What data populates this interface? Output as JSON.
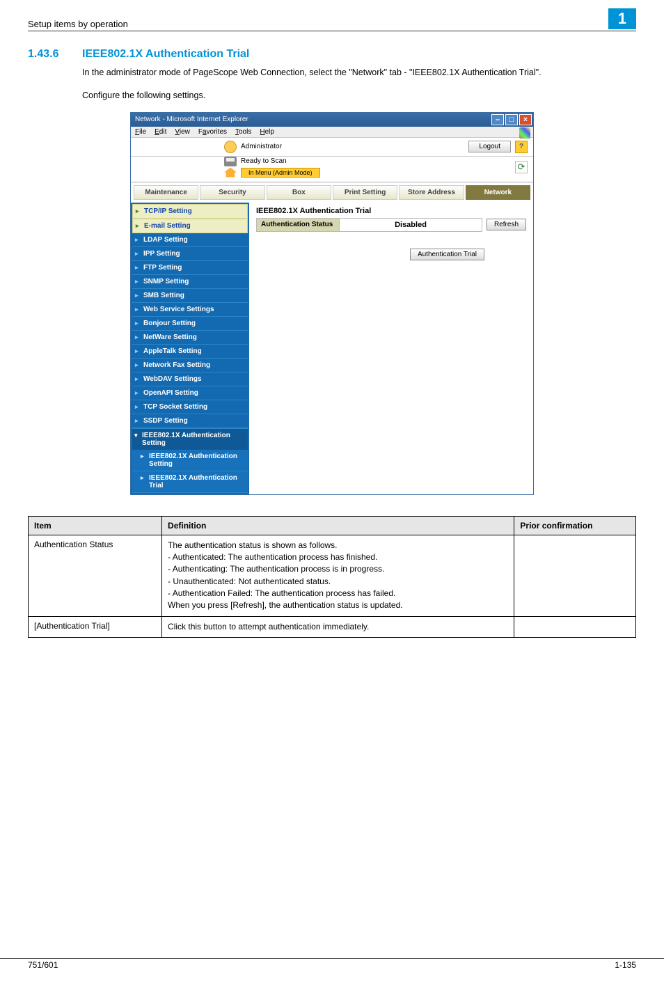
{
  "header": {
    "breadcrumb": "Setup items by operation",
    "chapter_badge": "1"
  },
  "section": {
    "number": "1.43.6",
    "title": "IEEE802.1X Authentication Trial",
    "para1": "In the administrator mode of PageScope Web Connection, select the \"Network\" tab - \"IEEE802.1X Authentication Trial\".",
    "para2": "Configure the following settings."
  },
  "browser": {
    "title": "Network - Microsoft Internet Explorer",
    "menus": {
      "file": "File",
      "edit": "Edit",
      "view": "View",
      "favorites": "Favorites",
      "tools": "Tools",
      "help": "Help"
    },
    "admin_label": "Administrator",
    "logout_label": "Logout",
    "ready_label": "Ready to Scan",
    "admin_mode_label": "In Menu (Admin Mode)",
    "tabs": {
      "maintenance": "Maintenance",
      "security": "Security",
      "box": "Box",
      "print": "Print Setting",
      "store": "Store Address",
      "network": "Network"
    },
    "sidebar": {
      "tcpip": "TCP/IP Setting",
      "email": "E-mail Setting",
      "ldap": "LDAP Setting",
      "ipp": "IPP Setting",
      "ftp": "FTP Setting",
      "snmp": "SNMP Setting",
      "smb": "SMB Setting",
      "webservice": "Web Service Settings",
      "bonjour": "Bonjour Setting",
      "netware": "NetWare Setting",
      "appletalk": "AppleTalk Setting",
      "netfax": "Network Fax Setting",
      "webdav": "WebDAV Settings",
      "openapi": "OpenAPI Setting",
      "tcpsocket": "TCP Socket Setting",
      "ssdp": "SSDP Setting",
      "ieee_group": "IEEE802.1X Authentication Setting",
      "ieee_child_setting": "IEEE802.1X Authentication Setting",
      "ieee_child_trial": "IEEE802.1X Authentication Trial"
    },
    "pane": {
      "title": "IEEE802.1X Authentication Trial",
      "auth_label": "Authentication Status",
      "auth_value": "Disabled",
      "refresh": "Refresh",
      "auth_trial_btn": "Authentication Trial"
    }
  },
  "def_table": {
    "h1": "Item",
    "h2": "Definition",
    "h3": "Prior confirmation",
    "rows": [
      {
        "item": "Authentication Status",
        "def_lines": [
          "The authentication status is shown as follows.",
          "- Authenticated: The authentication process has finished.",
          "- Authenticating: The authentication process is in progress.",
          "- Unauthenticated: Not authenticated status.",
          "- Authentication Failed: The authentication process has failed.",
          "When you press [Refresh], the authentication status is updated."
        ],
        "prior": ""
      },
      {
        "item": "[Authentication Trial]",
        "def_lines": [
          "Click this button to attempt authentication immediately."
        ],
        "prior": ""
      }
    ]
  },
  "footer": {
    "left": "751/601",
    "right": "1-135"
  }
}
